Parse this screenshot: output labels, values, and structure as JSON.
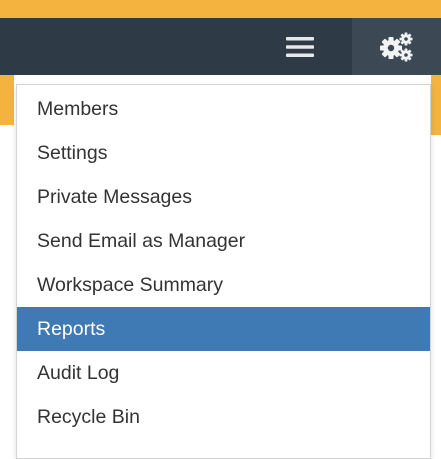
{
  "navbar": {
    "menu_icon": "hamburger-menu-icon",
    "settings_icon": "gears-icon"
  },
  "dropdown": {
    "items": [
      {
        "label": "Members"
      },
      {
        "label": "Settings"
      },
      {
        "label": "Private Messages"
      },
      {
        "label": "Send Email as Manager"
      },
      {
        "label": "Workspace Summary"
      },
      {
        "label": "Reports",
        "active": true
      },
      {
        "label": "Audit Log"
      },
      {
        "label": "Recycle Bin"
      }
    ]
  },
  "colors": {
    "accent": "#f4b33f",
    "navbar": "#2e3a45",
    "active_item": "#3f7ab4",
    "text": "#333333"
  }
}
